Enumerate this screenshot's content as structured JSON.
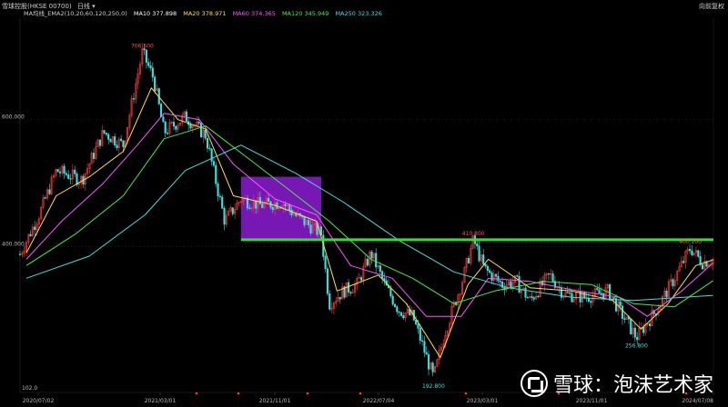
{
  "header": {
    "symbol": "雪球控股(HKSE 00700)",
    "period": "日线 ▾",
    "adjust": "向前复权",
    "ma_label": "MA均线_EMA2(10,20,60,120,250,0)",
    "ma_items": [
      {
        "text": "MA10 377.898",
        "color": "#ffffff"
      },
      {
        "text": "MA20 378.971",
        "color": "#ffe04a"
      },
      {
        "text": "MA60 374.365",
        "color": "#ff55ff"
      },
      {
        "text": "MA120 345.949",
        "color": "#44ee44"
      },
      {
        "text": "MA250 323.326",
        "color": "#44dddd"
      }
    ]
  },
  "watermark": {
    "text": "雪球：泡沫艺术家"
  },
  "colors": {
    "background": "#000000",
    "up": "#ff3b3b",
    "down": "#3fe0e0",
    "ma10": "#ffffff",
    "ma20": "#ffe04a",
    "ma60": "#ff55ff",
    "ma120": "#44ee44",
    "ma250": "#44dddd",
    "support_line": "#33dd33",
    "highlight_box": "#a020f0"
  },
  "chart_data": {
    "type": "line",
    "ylim": [
      170,
      760
    ],
    "y_ticks": [
      {
        "value": 600,
        "label": "600.000"
      },
      {
        "value": 400,
        "label": "400.000"
      }
    ],
    "x_ticks": [
      "2020/07/02",
      "2021/03/01",
      "2021/11/01",
      "2022/07/04",
      "2023/03/01",
      "2023/11/01",
      "2024/07/08"
    ],
    "x_range": [
      "2020-05-01",
      "2024-07-10"
    ],
    "bottom_left_label": "102.0",
    "series": [
      {
        "key": "price",
        "points": [
          [
            "2020-05-01",
            388
          ],
          [
            "2020-06-15",
            455
          ],
          [
            "2020-07-20",
            520
          ],
          [
            "2020-09-15",
            505
          ],
          [
            "2020-11-01",
            580
          ],
          [
            "2020-12-15",
            560
          ],
          [
            "2021-01-26",
            706.5
          ],
          [
            "2021-02-20",
            665
          ],
          [
            "2021-03-15",
            580
          ],
          [
            "2021-05-01",
            605
          ],
          [
            "2021-06-15",
            575
          ],
          [
            "2021-07-27",
            440
          ],
          [
            "2021-09-01",
            475
          ],
          [
            "2021-10-15",
            465
          ],
          [
            "2021-12-01",
            470
          ],
          [
            "2022-01-01",
            448
          ],
          [
            "2022-02-25",
            420
          ],
          [
            "2022-03-15",
            310
          ],
          [
            "2022-04-15",
            330
          ],
          [
            "2022-05-15",
            340
          ],
          [
            "2022-06-15",
            390
          ],
          [
            "2022-07-15",
            340
          ],
          [
            "2022-08-15",
            300
          ],
          [
            "2022-09-15",
            290
          ],
          [
            "2022-10-31",
            192.8
          ],
          [
            "2022-11-25",
            265
          ],
          [
            "2022-12-31",
            340
          ],
          [
            "2023-01-27",
            410.8
          ],
          [
            "2023-02-20",
            365
          ],
          [
            "2023-04-01",
            340
          ],
          [
            "2023-05-01",
            345
          ],
          [
            "2023-06-01",
            315
          ],
          [
            "2023-07-15",
            355
          ],
          [
            "2023-08-15",
            325
          ],
          [
            "2023-10-01",
            320
          ],
          [
            "2023-11-20",
            330
          ],
          [
            "2023-12-15",
            300
          ],
          [
            "2024-01-22",
            256.8
          ],
          [
            "2024-03-01",
            295
          ],
          [
            "2024-04-15",
            350
          ],
          [
            "2024-05-20",
            398
          ],
          [
            "2024-06-15",
            375
          ],
          [
            "2024-07-09",
            380
          ]
        ]
      },
      {
        "key": "ma20",
        "points": [
          [
            "2020-05-15",
            390
          ],
          [
            "2020-07-20",
            480
          ],
          [
            "2020-10-01",
            510
          ],
          [
            "2020-12-15",
            550
          ],
          [
            "2021-02-15",
            650
          ],
          [
            "2021-04-15",
            600
          ],
          [
            "2021-06-15",
            585
          ],
          [
            "2021-08-15",
            480
          ],
          [
            "2021-11-15",
            465
          ],
          [
            "2022-02-15",
            440
          ],
          [
            "2022-04-01",
            330
          ],
          [
            "2022-07-01",
            355
          ],
          [
            "2022-09-01",
            310
          ],
          [
            "2022-11-15",
            225
          ],
          [
            "2023-01-15",
            340
          ],
          [
            "2023-03-01",
            380
          ],
          [
            "2023-06-01",
            335
          ],
          [
            "2023-09-01",
            330
          ],
          [
            "2023-12-01",
            315
          ],
          [
            "2024-02-01",
            270
          ],
          [
            "2024-04-01",
            310
          ],
          [
            "2024-06-01",
            370
          ],
          [
            "2024-07-09",
            379
          ]
        ]
      },
      {
        "key": "ma60",
        "points": [
          [
            "2020-05-15",
            380
          ],
          [
            "2020-08-01",
            440
          ],
          [
            "2020-11-01",
            500
          ],
          [
            "2021-01-15",
            560
          ],
          [
            "2021-03-15",
            610
          ],
          [
            "2021-06-01",
            600
          ],
          [
            "2021-08-15",
            530
          ],
          [
            "2021-11-15",
            475
          ],
          [
            "2022-02-15",
            450
          ],
          [
            "2022-05-01",
            370
          ],
          [
            "2022-08-01",
            350
          ],
          [
            "2022-10-15",
            290
          ],
          [
            "2022-12-31",
            290
          ],
          [
            "2023-03-01",
            350
          ],
          [
            "2023-06-01",
            345
          ],
          [
            "2023-09-15",
            330
          ],
          [
            "2023-12-15",
            320
          ],
          [
            "2024-02-15",
            290
          ],
          [
            "2024-05-01",
            330
          ],
          [
            "2024-07-09",
            374
          ]
        ]
      },
      {
        "key": "ma120",
        "points": [
          [
            "2020-05-15",
            370
          ],
          [
            "2020-09-01",
            420
          ],
          [
            "2020-12-15",
            480
          ],
          [
            "2021-03-15",
            570
          ],
          [
            "2021-06-15",
            590
          ],
          [
            "2021-09-15",
            540
          ],
          [
            "2021-12-15",
            490
          ],
          [
            "2022-03-15",
            440
          ],
          [
            "2022-06-15",
            380
          ],
          [
            "2022-09-15",
            350
          ],
          [
            "2022-12-15",
            310
          ],
          [
            "2023-03-15",
            330
          ],
          [
            "2023-07-01",
            345
          ],
          [
            "2023-10-15",
            340
          ],
          [
            "2024-01-15",
            310
          ],
          [
            "2024-04-15",
            305
          ],
          [
            "2024-07-09",
            346
          ]
        ]
      },
      {
        "key": "ma250",
        "points": [
          [
            "2020-05-15",
            350
          ],
          [
            "2020-10-01",
            385
          ],
          [
            "2021-02-01",
            450
          ],
          [
            "2021-05-01",
            520
          ],
          [
            "2021-09-01",
            560
          ],
          [
            "2022-01-01",
            515
          ],
          [
            "2022-04-15",
            470
          ],
          [
            "2022-08-15",
            410
          ],
          [
            "2022-12-15",
            360
          ],
          [
            "2023-04-15",
            335
          ],
          [
            "2023-09-01",
            320
          ],
          [
            "2024-01-15",
            315
          ],
          [
            "2024-07-09",
            323
          ]
        ]
      }
    ],
    "horizontal_lines": [
      {
        "y": 410.8,
        "x_from": "2021-09-01",
        "x_to": "2024-07-10"
      }
    ],
    "highlight_region": {
      "x_from": "2021-09-01",
      "x_to": "2022-02-25",
      "y_from": 410,
      "y_to": 510
    },
    "annotations": [
      {
        "x": "2021-01-26",
        "y": 706.5,
        "label": "706.500",
        "color": "#ff5555"
      },
      {
        "x": "2023-01-27",
        "y": 410.8,
        "label": "410.800",
        "color": "#ff5555"
      },
      {
        "x": "2024-05-20",
        "y": 398,
        "label": "400.200",
        "color": "#ff5555"
      },
      {
        "x": "2022-10-31",
        "y": 192.8,
        "label": "192.800",
        "color": "#3fe0e0"
      },
      {
        "x": "2024-01-22",
        "y": 256.8,
        "label": "256.800",
        "color": "#3fe0e0"
      }
    ]
  }
}
